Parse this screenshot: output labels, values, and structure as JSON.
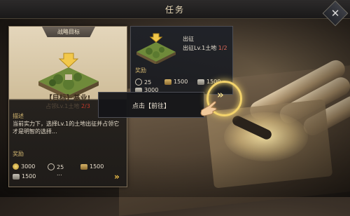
{
  "header": {
    "title": "任务"
  },
  "goal_card": {
    "tag": "战略目标",
    "title": "【目标】基业!",
    "subtitle": "占领Lv.1土地",
    "progress": "2/3",
    "desc_label": "描述",
    "desc_text": "当前实力下，选择Lv.1的土地出征并占领它才是明智的选择...",
    "reward_label": "奖励",
    "rewards": [
      {
        "icon": "coin-icon",
        "value": "3000"
      },
      {
        "icon": "ring-icon",
        "value": "25"
      },
      {
        "icon": "wood-icon",
        "value": "1500"
      },
      {
        "icon": "stone-icon",
        "value": "1500"
      }
    ],
    "more": "..."
  },
  "task_card": {
    "title": "出征",
    "subtitle": "出征Lv.1土地",
    "progress": "1/2",
    "reward_label": "奖励",
    "rewards": [
      {
        "icon": "ring-icon",
        "value": "25"
      },
      {
        "icon": "wood-icon",
        "value": "1500"
      },
      {
        "icon": "stone-icon",
        "value": "1500"
      },
      {
        "icon": "stone-icon",
        "value": "3000"
      }
    ]
  },
  "tooltip": {
    "text": "点击【前往】"
  },
  "icons": {
    "chevrons": "»",
    "close": "✕"
  },
  "colors": {
    "accent": "#f3d36b",
    "progress_red": "#c0392b"
  }
}
